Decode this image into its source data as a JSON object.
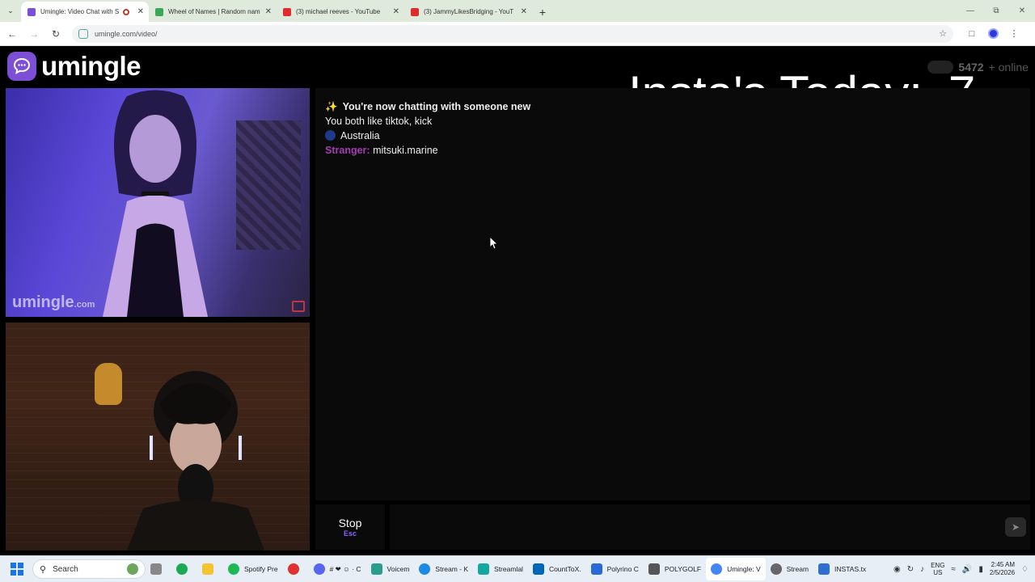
{
  "browser": {
    "tabs": [
      {
        "title": "Umingle: Video Chat with S",
        "color": "#7d4fd6",
        "active": true,
        "recording": true
      },
      {
        "title": "Wheel of Names | Random nam",
        "color": "#3aa757",
        "active": false
      },
      {
        "title": "(3) michael reeves - YouTube",
        "color": "#e02b2b",
        "active": false
      },
      {
        "title": "(3) JammyLikesBridging - YouT",
        "color": "#e02b2b",
        "active": false
      }
    ],
    "url": "umingle.com/video/"
  },
  "site": {
    "logo_text": "umingle",
    "online_count": "5472",
    "online_label": "+ online"
  },
  "overlay": {
    "label": "Insta's Today:",
    "count": "7"
  },
  "video": {
    "watermark": "umingle",
    "watermark_suffix": ".com"
  },
  "chat": {
    "intro": "You're now chatting with someone new",
    "common_interests": "You both like tiktok, kick",
    "country": "Australia",
    "stranger_label": "Stranger:",
    "stranger_message": "mitsuki.marine"
  },
  "controls": {
    "stop_label": "Stop",
    "stop_key": "Esc",
    "message_placeholder": ""
  },
  "taskbar": {
    "search_label": "Search",
    "apps": [
      {
        "label": "Spotify Pre",
        "color": "#1db954"
      },
      {
        "label": "",
        "color": "#e03030"
      },
      {
        "label": "# ❤ ☺ · C",
        "color": "#5865f2"
      },
      {
        "label": "Voicem",
        "color": "#2a9d8f"
      },
      {
        "label": "Stream - K",
        "color": "#1e88e5"
      },
      {
        "label": "Streamlal",
        "color": "#13a89e"
      },
      {
        "label": "CountToX.",
        "color": "#0066b8"
      },
      {
        "label": "Polyrino C",
        "color": "#2a6ad8"
      },
      {
        "label": "POLYGOLF",
        "color": "#555555"
      },
      {
        "label": "Umingle: V",
        "color": "#4285f4"
      },
      {
        "label": "Stream",
        "color": "#666666"
      },
      {
        "label": "INSTAS.tx",
        "color": "#2f6fd0"
      }
    ],
    "lang_top": "ENG",
    "lang_bottom": "US",
    "time": "2:45 AM",
    "date": "2/5/2026"
  }
}
